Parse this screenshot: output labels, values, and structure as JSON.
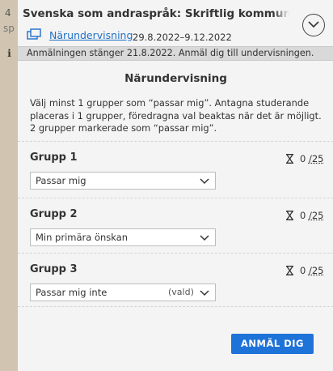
{
  "side": {
    "number": "4",
    "fragment": "sp"
  },
  "header": {
    "course_title": "Svenska som andraspråk: Skriftlig kommunikation, I",
    "mode_icon": "screens-icon",
    "mode_link": "Närundervisning",
    "dates": "29.8.2022–9.12.2022",
    "collapse_icon": "chevron-down-icon"
  },
  "info_bar": {
    "icon": "info-icon",
    "text": "Anmälningen stänger 21.8.2022. Anmäl dig till undervisningen."
  },
  "section": {
    "title": "Närundervisning",
    "instructions": [
      "Välj minst 1 grupper som “passar mig”. Antagna studerande",
      "placeras i 1 grupper, föredragna val beaktas när det är möjligt.",
      "2 grupper markerade som “passar mig”."
    ]
  },
  "groups": [
    {
      "name": "Grupp 1",
      "count": "0",
      "max": "/25",
      "selected": "Passar mig",
      "tag": ""
    },
    {
      "name": "Grupp 2",
      "count": "0",
      "max": "/25",
      "selected": "Min primära önskan",
      "tag": ""
    },
    {
      "name": "Grupp 3",
      "count": "0",
      "max": "/25",
      "selected": "Passar mig inte",
      "tag": "(vald)"
    }
  ],
  "submit_label": "ANMÄL DIG",
  "colors": {
    "accent": "#1e73d8",
    "link": "#1f6fc9",
    "info_bar_bg": "#d9d9d9"
  }
}
